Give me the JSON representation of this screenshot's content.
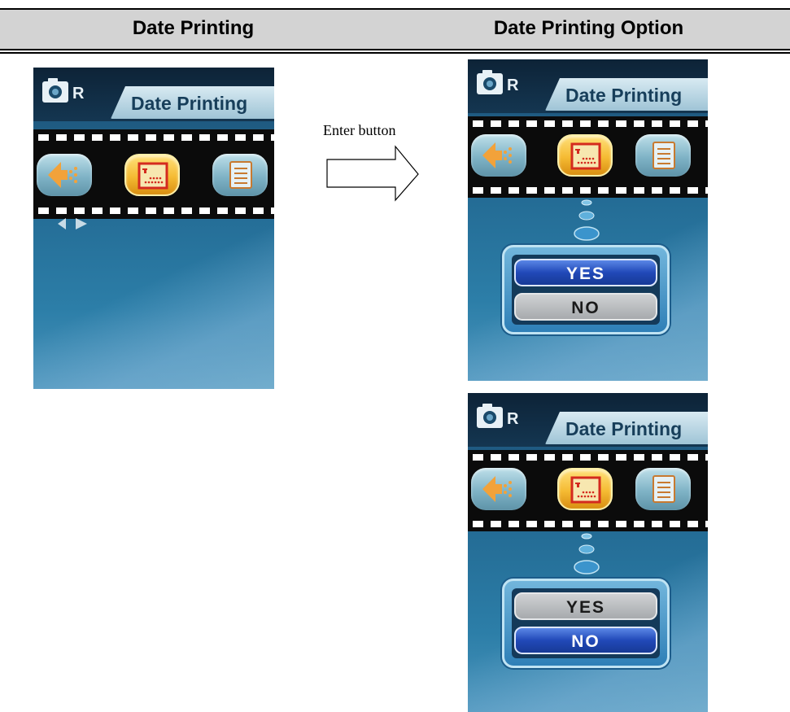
{
  "table": {
    "col1_header": "Date Printing",
    "col2_header": "Date Printing Option"
  },
  "transition": {
    "label": "Enter button"
  },
  "screens": [
    {
      "title": "Date Printing",
      "state": "menu",
      "icons": [
        "back-arrow-icon",
        "date-stamp-icon",
        "list-icon"
      ],
      "selected_icon": "date-stamp-icon"
    },
    {
      "title": "Date Printing",
      "state": "options",
      "options": [
        "YES",
        "NO"
      ],
      "highlighted": "YES"
    },
    {
      "title": "Date Printing",
      "state": "options",
      "options": [
        "YES",
        "NO"
      ],
      "highlighted": "NO"
    }
  ],
  "colors": {
    "header_bg": "#d3d3d3",
    "screen_blue": "#236a93",
    "selected_gold": "#f5bb33",
    "option_highlight": "#2149b8",
    "option_normal": "#a7aaad"
  }
}
